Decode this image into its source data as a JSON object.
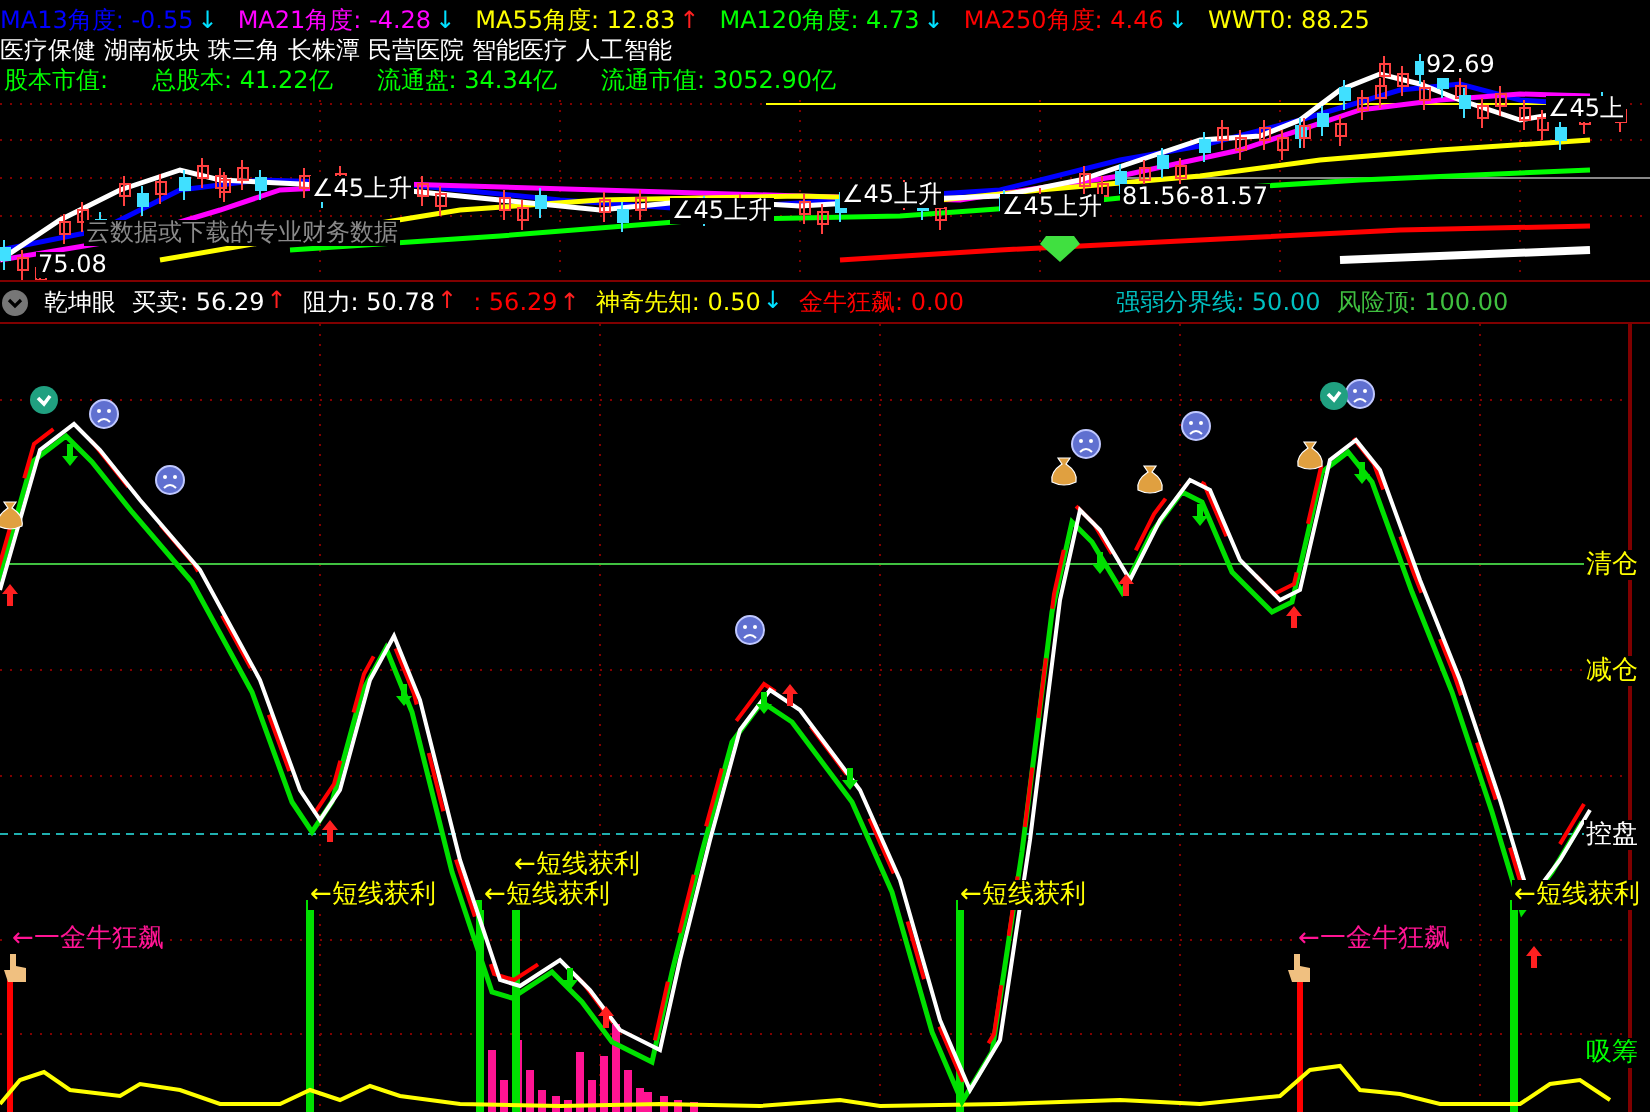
{
  "ma_legend": [
    {
      "label": "MA13角度: -0.55",
      "color": "#0000ff",
      "arrow": {
        "text": "↓",
        "color": "#00e0ff"
      }
    },
    {
      "label": "MA21角度: -4.28",
      "color": "#ff00ff",
      "arrow": {
        "text": "↓",
        "color": "#00e0ff"
      }
    },
    {
      "label": "MA55角度: 12.83",
      "color": "#ffff00",
      "arrow": {
        "text": "↑",
        "color": "#ff2020"
      }
    },
    {
      "label": "MA120角度: 4.73",
      "color": "#00ff00",
      "arrow": {
        "text": "↓",
        "color": "#00e0ff"
      }
    },
    {
      "label": "MA250角度: 4.46",
      "color": "#ff0000",
      "arrow": {
        "text": "↓",
        "color": "#00e0ff"
      }
    },
    {
      "label": "WWT0: 88.25",
      "color": "#ffff00"
    }
  ],
  "sectors": [
    "医疗保健",
    "湖南板块",
    "珠三角",
    "长株潭",
    "民营医院",
    "智能医疗",
    "人工智能"
  ],
  "capital": [
    "股本市值:",
    "总股本: 41.22亿",
    "流通盘: 34.34亿",
    "流通市值: 3052.90亿"
  ],
  "price_chart": {
    "labels": [
      {
        "text": "云数据或下载的专业财务数据",
        "kind": "note"
      },
      {
        "text": "75.08",
        "kind": "price"
      },
      {
        "text": "∠45上升",
        "kind": "angle"
      },
      {
        "text": "∠45上升",
        "kind": "angle"
      },
      {
        "text": "∠45上升",
        "kind": "angle"
      },
      {
        "text": "∠45上升",
        "kind": "angle"
      },
      {
        "text": "81.56-81.57",
        "kind": "price"
      },
      {
        "text": "92.69",
        "kind": "price"
      },
      {
        "text": "∠45上",
        "kind": "angle"
      }
    ]
  },
  "indicator_bar": {
    "name": "乾坤眼",
    "values": [
      {
        "label": "买卖: 56.29",
        "color": "#ffffff",
        "arrow": {
          "text": "↑",
          "color": "#ff2020"
        }
      },
      {
        "label": "阻力: 50.78",
        "color": "#ffffff",
        "arrow": {
          "text": "↑",
          "color": "#ff2020"
        }
      },
      {
        "label": ": 56.29",
        "color": "#ff0000",
        "arrow": {
          "text": "↑",
          "color": "#ff2020"
        }
      },
      {
        "label": "神奇先知: 0.50",
        "color": "#ffff00",
        "arrow": {
          "text": "↓",
          "color": "#00e0ff"
        }
      },
      {
        "label": "金牛狂飙: 0.00",
        "color": "#ff0000"
      },
      {
        "label": "强弱分界线: 50.00",
        "color": "#00c0c0"
      },
      {
        "label": "风险顶: 100.00",
        "color": "#40c040"
      }
    ]
  },
  "indicator_chart": {
    "levels": [
      {
        "text": "清仓",
        "color": "#ffff00"
      },
      {
        "text": "减仓",
        "color": "#ffff00"
      },
      {
        "text": "控盘",
        "color": "#ffffff"
      },
      {
        "text": "吸筹",
        "color": "#00ff00"
      }
    ],
    "signals": [
      {
        "text": "←一金牛狂飙",
        "kind": "bull"
      },
      {
        "text": "←短线获利",
        "kind": "profit"
      },
      {
        "text": "←短线获利",
        "kind": "profit"
      },
      {
        "text": "←短线获利",
        "kind": "profit"
      },
      {
        "text": "←短线获利",
        "kind": "profit"
      },
      {
        "text": "←一金牛狂飙",
        "kind": "bull"
      },
      {
        "text": "←短线获利",
        "kind": "profit"
      }
    ]
  }
}
